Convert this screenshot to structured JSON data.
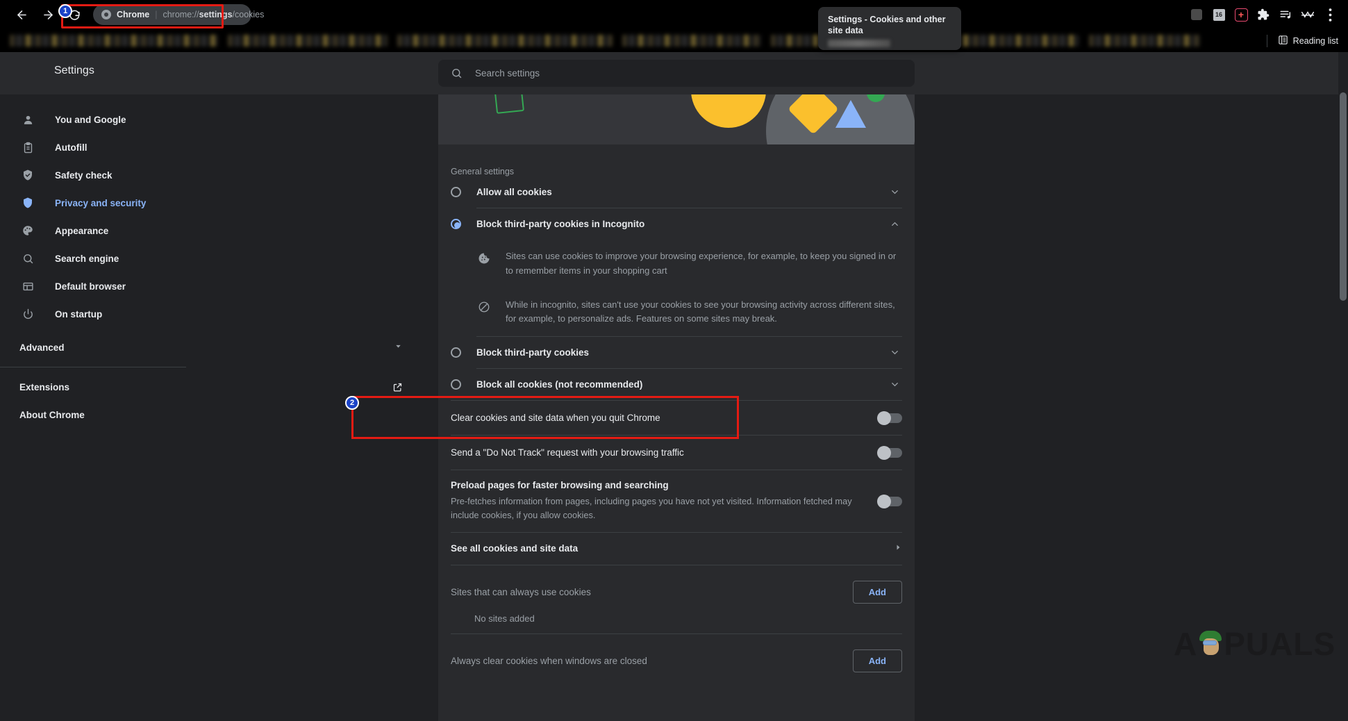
{
  "browser": {
    "nav": {
      "back": "back-arrow",
      "forward": "forward-arrow",
      "reload": "reload-arrow"
    },
    "omnibox": {
      "site_label": "Chrome",
      "separator": "|",
      "url_prefix": "chrome://",
      "url_bold": "settings",
      "url_suffix": "/cookies"
    },
    "toolbar_icons": [
      "profile-chip",
      "16-badge-icon",
      "red-plus-extension-icon",
      "extensions-puzzle-icon",
      "playlist-icon",
      "wave-icon",
      "chrome-menu-icon"
    ],
    "toolbar_chip_16": "16",
    "tab_tooltip": "Settings - Cookies and other site data",
    "reading_list": "Reading list"
  },
  "badges": {
    "one": "1",
    "two": "2"
  },
  "settings": {
    "title": "Settings",
    "search_placeholder": "Search settings",
    "sidebar": {
      "items": [
        {
          "label": "You and Google",
          "icon": "person-icon",
          "active": false
        },
        {
          "label": "Autofill",
          "icon": "clipboard-icon",
          "active": false
        },
        {
          "label": "Safety check",
          "icon": "shield-check-icon",
          "active": false
        },
        {
          "label": "Privacy and security",
          "icon": "shield-icon",
          "active": true
        },
        {
          "label": "Appearance",
          "icon": "palette-icon",
          "active": false
        },
        {
          "label": "Search engine",
          "icon": "search-icon",
          "active": false
        },
        {
          "label": "Default browser",
          "icon": "window-icon",
          "active": false
        },
        {
          "label": "On startup",
          "icon": "power-icon",
          "active": false
        }
      ],
      "advanced": "Advanced",
      "extensions": "Extensions",
      "about": "About Chrome"
    },
    "main": {
      "general_settings_label": "General settings",
      "options": [
        {
          "label": "Allow all cookies",
          "selected": false
        },
        {
          "label": "Block third-party cookies in Incognito",
          "selected": true
        },
        {
          "label": "Block third-party cookies",
          "selected": false
        },
        {
          "label": "Block all cookies (not recommended)",
          "selected": false
        }
      ],
      "incognito_details": [
        {
          "icon": "cookie-icon",
          "text": "Sites can use cookies to improve your browsing experience, for example, to keep you signed in or to remember items in your shopping cart"
        },
        {
          "icon": "blocked-icon",
          "text": "While in incognito, sites can't use your cookies to see your browsing activity across different sites, for example, to personalize ads. Features on some sites may break."
        }
      ],
      "toggles": [
        {
          "label": "Clear cookies and site data when you quit Chrome",
          "on": false
        },
        {
          "label": "Send a \"Do Not Track\" request with your browsing traffic",
          "on": false
        }
      ],
      "preload": {
        "title": "Preload pages for faster browsing and searching",
        "subtitle": "Pre-fetches information from pages, including pages you have not yet visited. Information fetched may include cookies, if you allow cookies.",
        "on": false
      },
      "see_all": "See all cookies and site data",
      "always_allow": {
        "label": "Sites that can always use cookies",
        "button": "Add",
        "empty": "No sites added"
      },
      "always_clear": {
        "label": "Always clear cookies when windows are closed",
        "button": "Add"
      }
    }
  },
  "watermark": "APPUALS",
  "colors": {
    "accent": "#8ab4f8",
    "highlight": "#e41b13",
    "badge": "#1a43c8",
    "bg": "#202124",
    "card": "#292a2d"
  }
}
